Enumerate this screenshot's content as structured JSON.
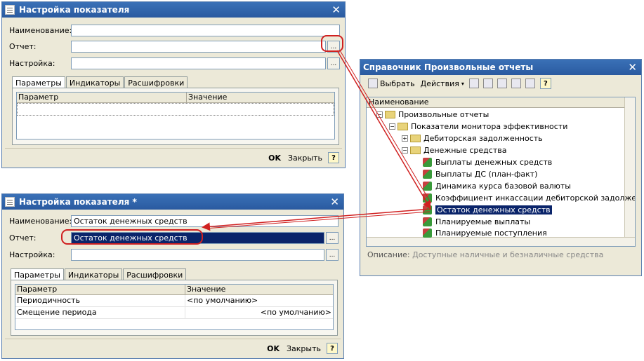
{
  "win1": {
    "title": "Настройка показателя",
    "name_label": "Наименование:",
    "report_label": "Отчет:",
    "setting_label": "Настройка:",
    "name_value": "",
    "report_value": "",
    "setting_value": "",
    "dots": "...",
    "tabs": [
      "Параметры",
      "Индикаторы",
      "Расшифровки"
    ],
    "grid_head": [
      "Параметр",
      "Значение"
    ],
    "ok": "OK",
    "close": "Закрыть",
    "help": "?"
  },
  "win2": {
    "title": "Настройка показателя *",
    "name_label": "Наименование:",
    "report_label": "Отчет:",
    "setting_label": "Настройка:",
    "name_value": "Остаток денежных средств",
    "report_value": "Остаток денежных средств",
    "setting_value": "",
    "dots": "...",
    "tabs": [
      "Параметры",
      "Индикаторы",
      "Расшифровки"
    ],
    "grid_head": [
      "Параметр",
      "Значение"
    ],
    "rows": [
      {
        "param": "Периодичность",
        "value": "<по умолчанию>"
      },
      {
        "param": "Смещение периода",
        "value": "<по умолчанию>"
      }
    ],
    "ok": "OK",
    "close": "Закрыть",
    "help": "?"
  },
  "ref": {
    "title": "Справочник Произвольные отчеты",
    "select": "Выбрать",
    "actions": "Действия",
    "help": "?",
    "column": "Наименование",
    "tree": [
      "Произвольные отчеты",
      "Показатели монитора эффективности",
      "Дебиторская задолженность",
      "Денежные средства",
      "Выплаты денежных средств",
      "Выплаты ДС (план-факт)",
      "Динамика курса базовой валюты",
      "Коэффициент инкассации дебиторской задолженности",
      "Остаток денежных средств",
      "Планируемые выплаты",
      "Планируемые поступления"
    ],
    "desc_label": "Описание:",
    "desc_value": "Доступные наличные и безналичные средства"
  },
  "colors": {
    "accent": "#2a5aa0",
    "arrow": "#d02020",
    "selection": "#0a246a"
  }
}
